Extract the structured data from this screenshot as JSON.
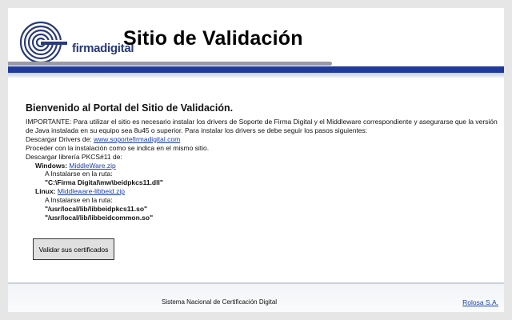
{
  "header": {
    "logo_text": "firmadigital",
    "title": "Sitio de Validación"
  },
  "main": {
    "welcome": "Bienvenido al Portal del Sitio de Validación.",
    "notice_1": "IMPORTANTE: Para utilizar el sitio es necesario instalar los drivers de Soporte de Firma Digital y el Middleware correspondiente y asegurarse que la versión de Java instalada en su equipo sea 8u45 o superior. Para instalar los drivers se debe seguir los pasos siguientes:",
    "drivers_label": "Descargar Drivers de: ",
    "drivers_link": "www.soportefirmadigital.com",
    "proceed": "Proceder con la instalación como se indica en el mismo sitio.",
    "pkcs_label": "Descargar librería PKCS#11 de:",
    "windows_label": "Windows: ",
    "windows_link": "MiddleWare.zip",
    "install_route_1": "A Instalarse en la ruta:",
    "windows_path": "\"C:\\Firma Digital\\mw\\beidpkcs11.dll\"",
    "linux_label": "Linux: ",
    "linux_link": "Middleware-libbeid.zip",
    "install_route_2": "A Instalarse en la ruta:",
    "linux_path_1": "\"/usr/local/lib/libbeidpkcs11.so\"",
    "linux_path_2": "\"/usr/local/lib/libbeidcommon.so\"",
    "validate_button": "Validar sus certificados"
  },
  "footer": {
    "center_text": "Sistema Nacional de Certificación Digital",
    "right_link": "Rolosa S.A."
  },
  "colors": {
    "brand_blue": "#1f3a9a",
    "link_blue": "#1a3fa8",
    "grey_bar": "#9a9aa6"
  }
}
